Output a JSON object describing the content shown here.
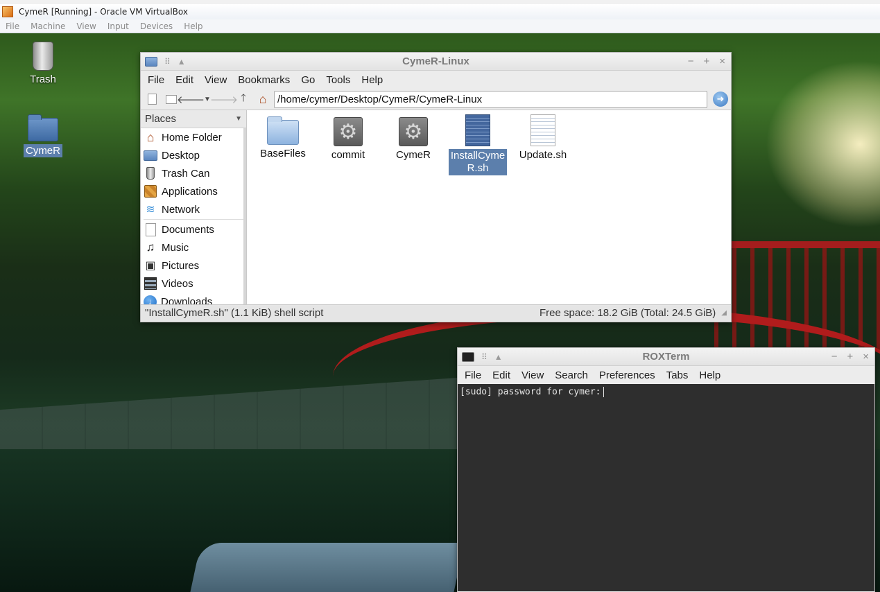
{
  "host": {
    "title": "CymeR [Running] - Oracle VM VirtualBox",
    "menu": [
      "File",
      "Machine",
      "View",
      "Input",
      "Devices",
      "Help"
    ]
  },
  "desktop": {
    "icons": [
      {
        "label": "Trash",
        "icon": "trash-icon"
      },
      {
        "label": "CymeR",
        "icon": "folder-icon",
        "selected": true
      }
    ]
  },
  "file_manager": {
    "title": "CymeR-Linux",
    "menu": [
      "File",
      "Edit",
      "View",
      "Bookmarks",
      "Go",
      "Tools",
      "Help"
    ],
    "path": "/home/cymer/Desktop/CymeR/CymeR-Linux",
    "sidebar_title": "Places",
    "places": [
      {
        "label": "Home Folder",
        "icon": "home-icon"
      },
      {
        "label": "Desktop",
        "icon": "folder-icon"
      },
      {
        "label": "Trash Can",
        "icon": "trash-icon"
      },
      {
        "label": "Applications",
        "icon": "applications-icon"
      },
      {
        "label": "Network",
        "icon": "network-icon"
      },
      {
        "label": "Documents",
        "icon": "document-icon"
      },
      {
        "label": "Music",
        "icon": "music-icon"
      },
      {
        "label": "Pictures",
        "icon": "pictures-icon"
      },
      {
        "label": "Videos",
        "icon": "videos-icon"
      },
      {
        "label": "Downloads",
        "icon": "downloads-icon"
      }
    ],
    "files": [
      {
        "name": "BaseFiles",
        "type": "folder"
      },
      {
        "name": "commit",
        "type": "executable"
      },
      {
        "name": "CymeR",
        "type": "executable"
      },
      {
        "name": "InstallCymeR.sh",
        "name_lines": [
          "InstallCyme",
          "R.sh"
        ],
        "type": "script",
        "selected": true
      },
      {
        "name": "Update.sh",
        "type": "script"
      }
    ],
    "status_left": "\"InstallCymeR.sh\" (1.1 KiB) shell script",
    "status_right": "Free space: 18.2 GiB (Total: 24.5 GiB)"
  },
  "terminal": {
    "title": "ROXTerm",
    "menu": [
      "File",
      "Edit",
      "View",
      "Search",
      "Preferences",
      "Tabs",
      "Help"
    ],
    "line": "[sudo] password for cymer:"
  }
}
